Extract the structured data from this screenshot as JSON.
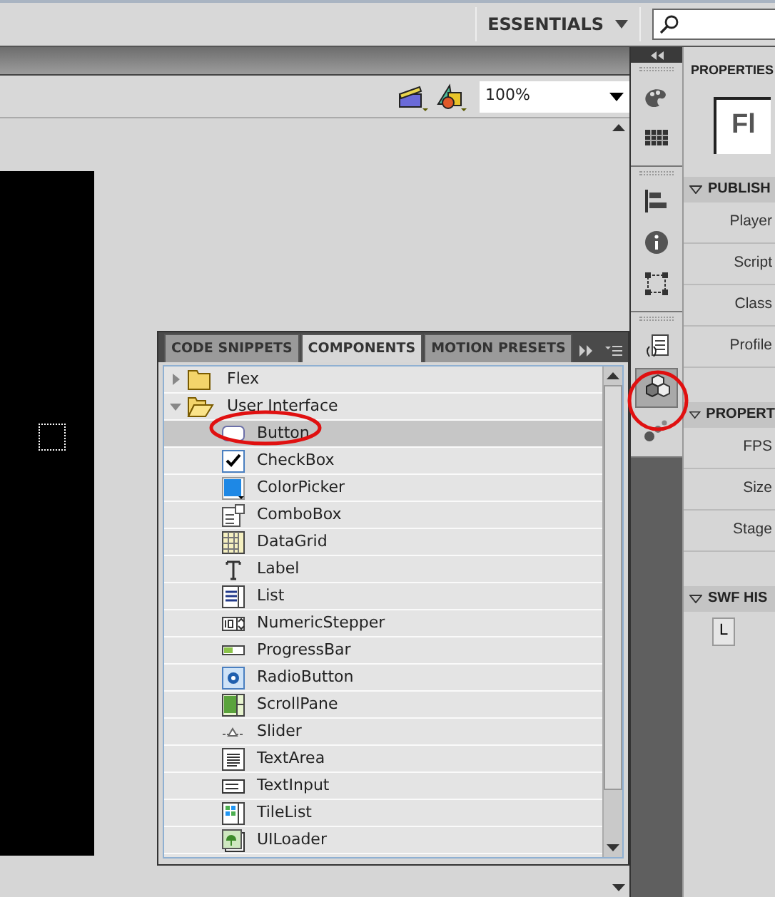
{
  "top_bar": {
    "workspace": "ESSENTIALS"
  },
  "document_toolbar": {
    "zoom": "100%"
  },
  "components_panel": {
    "tabs": [
      {
        "label": "CODE SNIPPETS",
        "selected": false
      },
      {
        "label": "COMPONENTS",
        "selected": true
      },
      {
        "label": "MOTION PRESETS",
        "selected": false
      }
    ],
    "tree": [
      {
        "label": "Flex",
        "expanded": false
      },
      {
        "label": "User Interface",
        "expanded": true,
        "children": [
          {
            "label": "Button",
            "kind": "button",
            "selected": true
          },
          {
            "label": "CheckBox",
            "kind": "checkbox",
            "selected": false
          },
          {
            "label": "ColorPicker",
            "kind": "colorpicker",
            "selected": false
          },
          {
            "label": "ComboBox",
            "kind": "combobox",
            "selected": false
          },
          {
            "label": "DataGrid",
            "kind": "datagrid",
            "selected": false
          },
          {
            "label": "Label",
            "kind": "label",
            "selected": false
          },
          {
            "label": "List",
            "kind": "list",
            "selected": false
          },
          {
            "label": "NumericStepper",
            "kind": "stepper",
            "selected": false
          },
          {
            "label": "ProgressBar",
            "kind": "progress",
            "selected": false
          },
          {
            "label": "RadioButton",
            "kind": "radio",
            "selected": false
          },
          {
            "label": "ScrollPane",
            "kind": "scrollpane",
            "selected": false
          },
          {
            "label": "Slider",
            "kind": "slider",
            "selected": false
          },
          {
            "label": "TextArea",
            "kind": "textarea",
            "selected": false
          },
          {
            "label": "TextInput",
            "kind": "textinput",
            "selected": false
          },
          {
            "label": "TileList",
            "kind": "tilelist",
            "selected": false
          },
          {
            "label": "UILoader",
            "kind": "loader",
            "selected": false
          }
        ]
      }
    ]
  },
  "dock_groups": [
    [
      {
        "kind": "palette",
        "selected": false
      },
      {
        "kind": "swatches",
        "selected": false
      }
    ],
    [
      {
        "kind": "align",
        "selected": false
      },
      {
        "kind": "info",
        "selected": false
      },
      {
        "kind": "transform",
        "selected": false
      }
    ],
    [
      {
        "kind": "code",
        "selected": false
      },
      {
        "kind": "components",
        "selected": true
      },
      {
        "kind": "motion",
        "selected": false
      }
    ]
  ],
  "properties_panel": {
    "title": "PROPERTIES",
    "logo": "Fl",
    "sections": [
      {
        "title": "PUBLISH",
        "fields": [
          "Player",
          "Script",
          "Class",
          "Profile"
        ]
      },
      {
        "title": "PROPERT",
        "fields": [
          "FPS",
          "Size",
          "Stage"
        ]
      },
      {
        "title": "SWF HIS",
        "button": "L"
      }
    ]
  }
}
